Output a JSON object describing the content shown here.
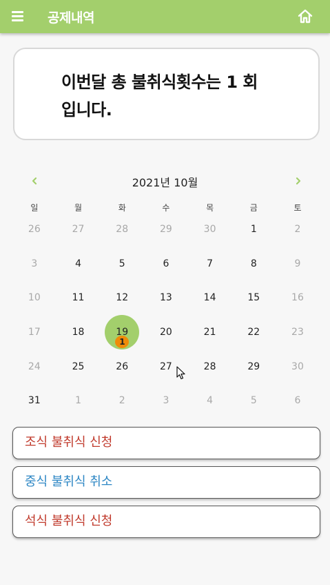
{
  "appbar": {
    "title": "공제내역",
    "color": "#a3cf6c"
  },
  "summary": {
    "text": "이번달 총 불취식횟수는 1 회 입니다."
  },
  "calendar": {
    "title": "2021년 10월",
    "weekdays": [
      "일",
      "월",
      "화",
      "수",
      "목",
      "금",
      "토"
    ],
    "days": [
      {
        "label": "26",
        "muted": true
      },
      {
        "label": "27",
        "muted": true
      },
      {
        "label": "28",
        "muted": true
      },
      {
        "label": "29",
        "muted": true
      },
      {
        "label": "30",
        "muted": true
      },
      {
        "label": "1"
      },
      {
        "label": "2",
        "muted": true
      },
      {
        "label": "3",
        "muted": true
      },
      {
        "label": "4"
      },
      {
        "label": "5"
      },
      {
        "label": "6"
      },
      {
        "label": "7"
      },
      {
        "label": "8"
      },
      {
        "label": "9",
        "muted": true
      },
      {
        "label": "10",
        "muted": true
      },
      {
        "label": "11"
      },
      {
        "label": "12"
      },
      {
        "label": "13"
      },
      {
        "label": "14"
      },
      {
        "label": "15"
      },
      {
        "label": "16",
        "muted": true
      },
      {
        "label": "17",
        "muted": true
      },
      {
        "label": "18"
      },
      {
        "label": "19",
        "selected": true,
        "badge": "1"
      },
      {
        "label": "20"
      },
      {
        "label": "21"
      },
      {
        "label": "22"
      },
      {
        "label": "23",
        "muted": true
      },
      {
        "label": "24",
        "muted": true
      },
      {
        "label": "25"
      },
      {
        "label": "26"
      },
      {
        "label": "27"
      },
      {
        "label": "28"
      },
      {
        "label": "29"
      },
      {
        "label": "30",
        "muted": true
      },
      {
        "label": "31"
      },
      {
        "label": "1",
        "muted": true
      },
      {
        "label": "2",
        "muted": true
      },
      {
        "label": "3",
        "muted": true
      },
      {
        "label": "4",
        "muted": true
      },
      {
        "label": "5",
        "muted": true
      },
      {
        "label": "6",
        "muted": true
      }
    ],
    "selected_color": "#a3cf6c",
    "badge_color": "#ef8b08"
  },
  "actions": [
    {
      "label": "조식 불취식 신청",
      "color": "#c0392b"
    },
    {
      "label": "중식 불취식 취소",
      "color": "#2c86c4"
    },
    {
      "label": "석식 불취식 신청",
      "color": "#c0392b"
    }
  ]
}
